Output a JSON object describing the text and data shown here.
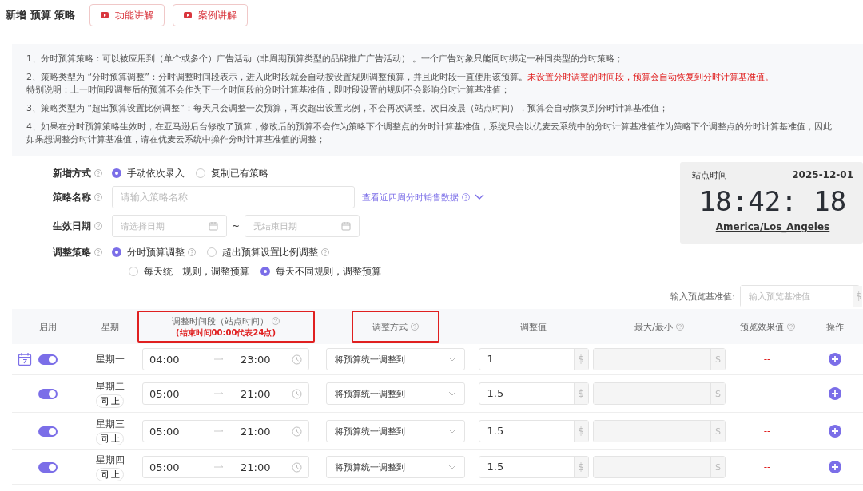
{
  "title": "新增 预算 策略",
  "buttons": [
    {
      "label": "功能讲解"
    },
    {
      "label": "案例讲解"
    }
  ],
  "notes": [
    {
      "lines": [
        {
          "text": "1、分时预算策略：可以被应用到（单个或多个）广告活动（非周期预算类型的品牌推广广告活动）  。一个广告对象只能同时绑定一种同类型的分时策略；"
        }
      ]
    },
    {
      "lines": [
        {
          "text": "2、策略类型为 “分时预算调整”：分时调整时间段表示，进入此时段就会自动按设置规则调整预算，并且此时段一直使用该预算。",
          "alert": "未设置分时调整的时间段，预算会自动恢复到分时计算基准值。"
        },
        {
          "text": "特别说明：上一时间段调整后的预算不会作为下一个时间段的分时计算基准值，即时段设置的规则不会影响分时计算基准值；"
        }
      ]
    },
    {
      "lines": [
        {
          "text": "3、策略类型为 “超出预算设置比例调整”：每天只会调整一次预算，再次超出设置比例，不会再次调整。次日凌晨（站点时间），预算会自动恢复到分时计算基准值；"
        }
      ]
    },
    {
      "lines": [
        {
          "text": "4、如果在分时预算策略生效时，在亚马逊后台修改了预算，修改后的预算不会作为策略下个调整点的分时计算基准值，系统只会以优麦云系统中的分时计算基准值作为策略下个调整点的分时计算基准值，因此"
        },
        {
          "text": "如果想调整分时计算基准值，请在优麦云系统中操作分时计算基准值的调整；"
        }
      ]
    }
  ],
  "form": {
    "add_mode": {
      "label": "新增方式",
      "options": [
        {
          "label": "手动依次录入",
          "selected": true
        },
        {
          "label": "复制已有策略",
          "selected": false
        }
      ]
    },
    "name": {
      "label": "策略名称",
      "placeholder": "请输入策略名称",
      "link": "查看近四周分时销售数据"
    },
    "date": {
      "label": "生效日期",
      "start_placeholder": "请选择日期",
      "separator": "~",
      "end_placeholder": "无结束日期"
    },
    "strategy": {
      "label": "调整策略",
      "options": [
        {
          "label": "分时预算调整",
          "selected": true,
          "help": true
        },
        {
          "label": "超出预算设置比例调整",
          "selected": false,
          "help": true
        }
      ],
      "sub_options": [
        {
          "label": "每天统一规则，调整预算",
          "selected": false
        },
        {
          "label": "每天不同规则，调整预算",
          "selected": true
        }
      ]
    }
  },
  "clock": {
    "label": "站点时间",
    "date": "2025-12-01",
    "time": "18:42: 18",
    "timezone": "America/Los_Angeles"
  },
  "preview": {
    "label": "输入预览基准值:",
    "placeholder": "输入预览基准值",
    "unit": "$"
  },
  "table": {
    "columns": [
      {
        "label": "启用",
        "help": false,
        "highlighted": false
      },
      {
        "label": "星期",
        "help": false,
        "highlighted": false
      },
      {
        "label": "调整时间段（站点时间）",
        "note": "(结束时间**00:00**代表**24**点)",
        "help": true,
        "highlighted": true
      },
      {
        "label": "调整方式",
        "help": true,
        "highlighted": true
      },
      {
        "label": "调整值",
        "help": false,
        "highlighted": false
      },
      {
        "label": "最大/最小",
        "help": true,
        "highlighted": false
      },
      {
        "label": "预览效果值",
        "help": true,
        "highlighted": false
      },
      {
        "label": "操作",
        "help": false,
        "highlighted": false
      }
    ],
    "rows": [
      {
        "today": true,
        "enabled": true,
        "day": "星期一",
        "start": "04:00",
        "end": "23:00",
        "method": "将预算统一调整到",
        "value": "1",
        "unit": "$",
        "max_unit": "$",
        "preview": "--"
      },
      {
        "today": false,
        "enabled": true,
        "day": "星期二",
        "same": "同 上",
        "start": "05:00",
        "end": "21:00",
        "method": "将预算统一调整到",
        "value": "1.5",
        "unit": "$",
        "max_unit": "$",
        "preview": "--"
      },
      {
        "today": false,
        "enabled": true,
        "day": "星期三",
        "same": "同 上",
        "start": "05:00",
        "end": "21:00",
        "method": "将预算统一调整到",
        "value": "1.5",
        "unit": "$",
        "max_unit": "$",
        "preview": "--"
      },
      {
        "today": false,
        "enabled": true,
        "day": "星期四",
        "same": "同 上",
        "start": "05:00",
        "end": "21:00",
        "method": "将预算统一调整到",
        "value": "1.5",
        "unit": "$",
        "max_unit": "$",
        "preview": "--"
      }
    ]
  }
}
